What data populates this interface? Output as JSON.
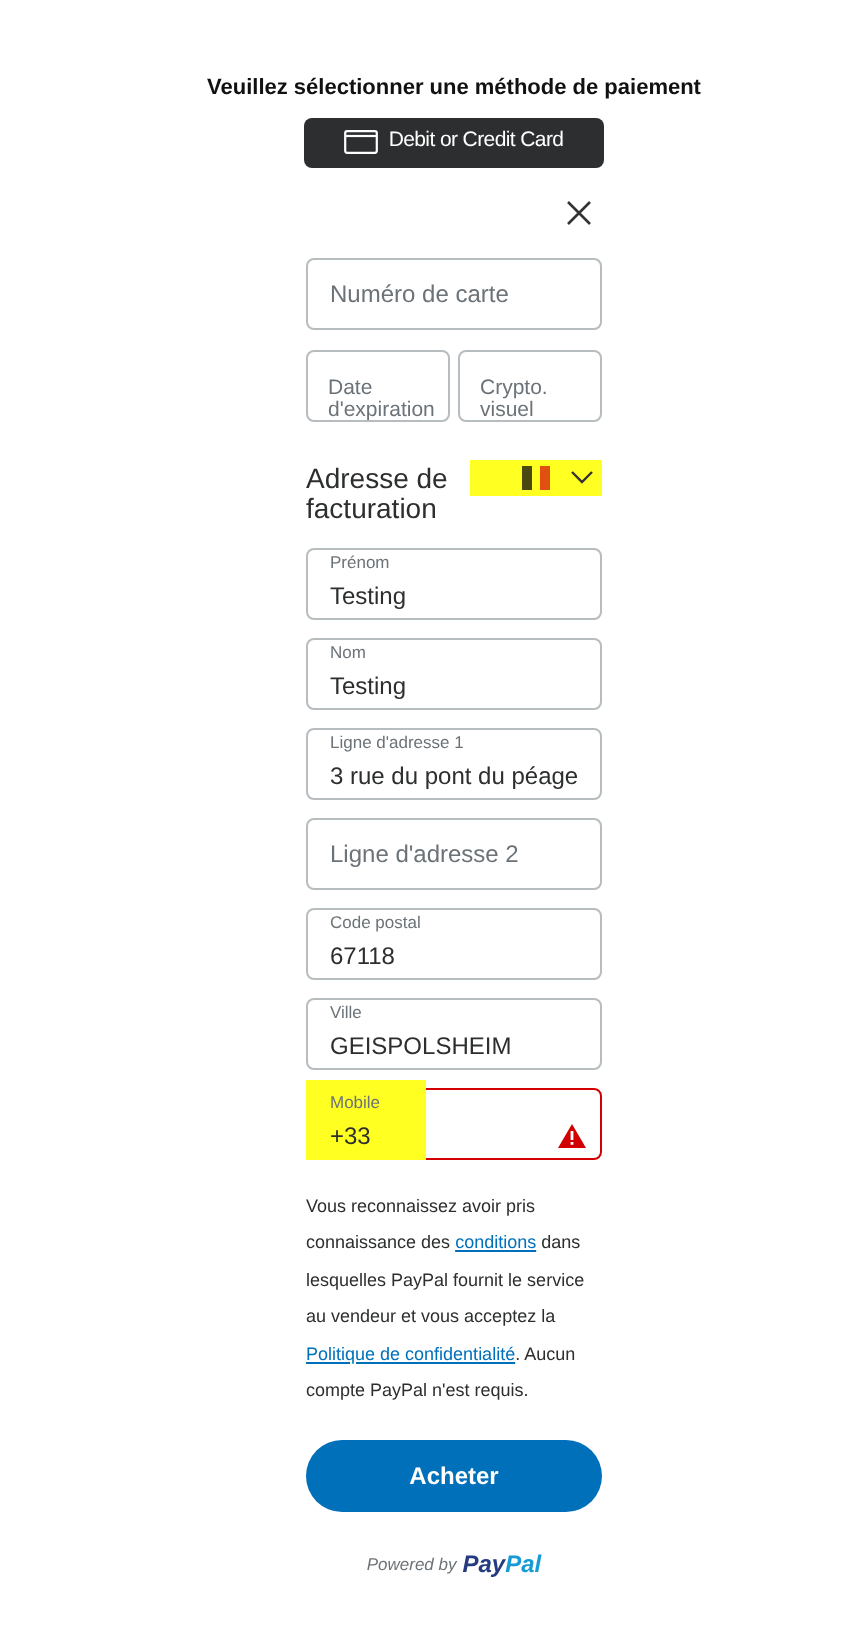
{
  "heading": "Veuillez sélectionner une méthode de paiement",
  "method_button": "Debit or Credit Card",
  "card_fields": [
    {
      "placeholder": "Numéro de carte"
    }
  ],
  "card_small_fields": [
    {
      "placeholder": "Date d'expiration"
    },
    {
      "placeholder": "Crypto. visuel"
    }
  ],
  "billing": {
    "label": "Adresse de facturation",
    "highlighted": true
  },
  "address_fields": [
    {
      "label": "Prénom",
      "value": "Testing",
      "error": false,
      "highlighted": false
    },
    {
      "label": "Nom",
      "value": "Testing",
      "error": false,
      "highlighted": false
    },
    {
      "label": "Ligne d'adresse 1",
      "value": "3 rue du pont du péage",
      "error": false,
      "highlighted": false
    },
    {
      "placeholder": "Ligne d'adresse 2",
      "error": false,
      "highlighted": false
    },
    {
      "label": "Code postal",
      "value": "67118",
      "error": false,
      "highlighted": false
    },
    {
      "label": "Ville",
      "value": "GEISPOLSHEIM",
      "error": false,
      "highlighted": false
    },
    {
      "label": "Mobile",
      "value": "+33",
      "error": true,
      "highlighted": true
    }
  ],
  "legal": [
    {
      "kind": "text",
      "text": "Vous reconnaissez avoir pris connaissance des "
    },
    {
      "kind": "link",
      "text": "conditions"
    },
    {
      "kind": "text",
      "text": " dans lesquelles PayPal fournit le service au vendeur et vous acceptez la "
    },
    {
      "kind": "link",
      "text": "Politique de confidentialité"
    },
    {
      "kind": "text",
      "text": ". Aucun compte PayPal n'est requis."
    }
  ],
  "buy_button": "Acheter",
  "powered_by": "Powered by",
  "brand": {
    "first": "Pay",
    "second": "Pal"
  }
}
